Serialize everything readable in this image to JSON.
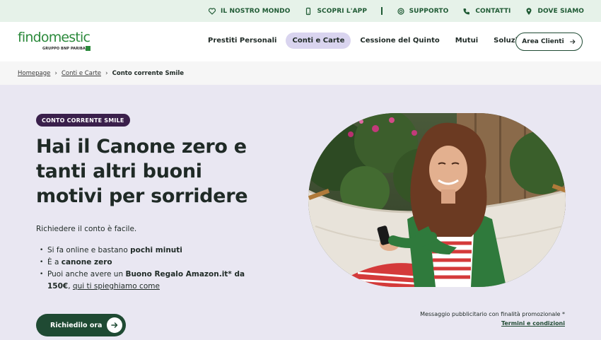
{
  "topbar": {
    "links": [
      {
        "label": "IL NOSTRO MONDO",
        "icon": "heart-icon"
      },
      {
        "label": "SCOPRI L'APP",
        "icon": "phone-icon"
      },
      {
        "label": "SUPPORTO",
        "icon": "support-icon"
      },
      {
        "label": "CONTATTI",
        "icon": "call-icon"
      },
      {
        "label": "DOVE SIAMO",
        "icon": "location-icon"
      }
    ]
  },
  "logo": {
    "name": "findomestic",
    "subtitle": "GRUPPO BNP PARIBAS"
  },
  "nav": {
    "items": [
      "Prestiti Personali",
      "Conti e Carte",
      "Cessione del Quinto",
      "Mutui",
      "Soluzioni"
    ],
    "active": "Conti e Carte",
    "area_clienti": "Area Clienti"
  },
  "breadcrumb": {
    "items": [
      "Homepage",
      "Conti e Carte"
    ],
    "current": "Conto corrente Smile"
  },
  "hero": {
    "badge": "CONTO CORRENTE SMILE",
    "headline_pre": "Hai il ",
    "headline_bold": "Canone zero",
    "headline_post": " e tanti altri buoni motivi per sorridere",
    "intro": "Richiedere il conto è facile.",
    "bullet1_pre": "Si fa online e bastano ",
    "bullet1_bold": "pochi minuti",
    "bullet2_pre": "È a ",
    "bullet2_bold": "canone zero",
    "bullet3_pre": "Puoi anche avere un ",
    "bullet3_bold": "Buono Regalo Amazon.it* da 150€",
    "bullet3_sep": ", ",
    "bullet3_link": "qui ti spieghiamo come",
    "cta": "Richiedilo ora",
    "promo_text": "Messaggio pubblicitario con finalità promozionale *",
    "promo_link": "Termini e condizioni"
  },
  "colors": {
    "brand_green": "#2c8a3c",
    "dark_green": "#1f4a33",
    "hero_bg": "#e9e7f2",
    "badge_bg": "#3a1f4b",
    "topbar_bg": "#e6f2e9",
    "active_nav_bg": "#d9d4ef"
  }
}
